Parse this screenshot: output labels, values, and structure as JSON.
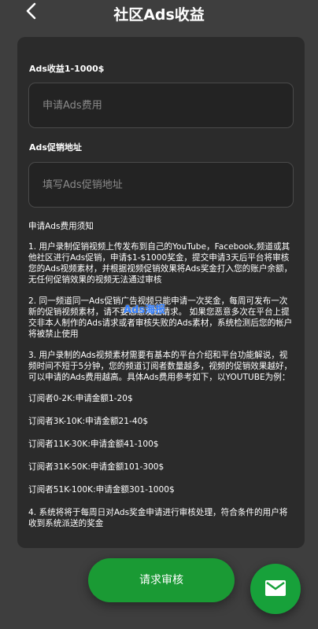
{
  "header": {
    "back_icon": "chevron-left-icon",
    "title": "社区Ads收益"
  },
  "form": {
    "fee_label": "Ads收益1-1000$",
    "fee_placeholder": "申请Ads费用",
    "url_label": "Ads促销地址",
    "url_placeholder": "填写Ads促销地址"
  },
  "notes": {
    "heading": "申请Ads费用须知",
    "rule1": "1. 用户录制促销视频上传发布到自己的YouTube，Facebook,频道或其他社区进行Ads促销，申请$1-$1000奖金，提交申请3天后平台将审核您的Ads视频素材，并根据视频促销效果将Ads奖金打入您的账户余额，无任何促销效果的视频无法通过审核",
    "rule2": "2. 同一频道同一Ads促销广告视频只能申请一次奖金，每周可发布一次新的促销视频素材，请不要恶意发送请求。 如果您恶意多次在平台上提交非本人制作的Ads请求或者审核失败的Ads素材，系统检测后您的帐户将被禁止使用",
    "rule3": "3. 用户录制的Ads视频素材需要有基本的平台介绍和平台功能解说，视频时间不短于5分钟，您的频道订阅者数量越多，视频的促销效果越好，可以申请的Ads费用越高。具体Ads费用参考如下，以YOUTUBE为例：",
    "tiers": [
      "订阅者0-2K:申请金额1-20$",
      "订阅者3K-10K:申请金额21-40$",
      "订阅者11K-30K:申请金额41-100$",
      "订阅者31K-50K:申请金额101-300$",
      "订阅者51K-100K:申请金额301-1000$"
    ],
    "rule4": "4. 系统将将于每周日对Ads奖金申请进行审核处理，符合条件的用户将收到系统派送的奖金"
  },
  "watermark": "Ads海报",
  "actions": {
    "submit_label": "请求审核",
    "fab_icon": "mail-icon"
  },
  "colors": {
    "background": "#3e3e3e",
    "card": "#2b2b2b",
    "accent_green": "#1a9a34"
  }
}
